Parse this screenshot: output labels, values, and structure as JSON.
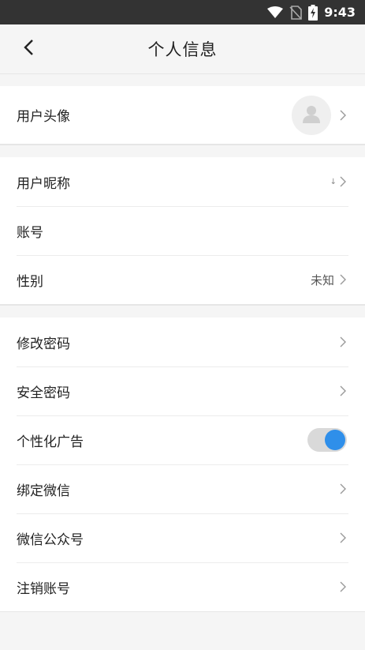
{
  "status_bar": {
    "time": "9:43",
    "icons": [
      "wifi-icon",
      "no-sim-icon",
      "battery-charging-icon"
    ]
  },
  "header": {
    "title": "个人信息",
    "back_icon": "chevron-left-icon"
  },
  "groups": {
    "profile": {
      "avatar_row": {
        "label": "用户头像",
        "avatar_icon": "user-avatar-icon"
      }
    },
    "account": {
      "nickname": {
        "label": "用户昵称",
        "value": "↓"
      },
      "account_no": {
        "label": "账号",
        "value": ""
      },
      "gender": {
        "label": "性别",
        "value": "未知"
      }
    },
    "settings": {
      "change_password": {
        "label": "修改密码"
      },
      "security_password": {
        "label": "安全密码"
      },
      "personalized_ads": {
        "label": "个性化广告",
        "enabled": true
      },
      "bind_wechat": {
        "label": "绑定微信"
      },
      "wechat_official": {
        "label": "微信公众号"
      },
      "cancel_account": {
        "label": "注销账号"
      }
    }
  },
  "colors": {
    "status_bar_bg": "#333333",
    "page_bg": "#f5f5f5",
    "toggle_on": "#2f8fea",
    "toggle_track": "#d9d9d9"
  }
}
